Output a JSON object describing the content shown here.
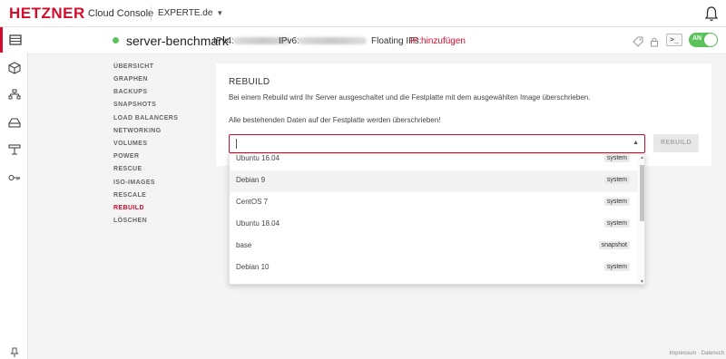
{
  "brand": {
    "logo": "HETZNER",
    "app_title": "Cloud Console"
  },
  "project": {
    "name": "EXPERTE.de"
  },
  "server": {
    "name": "server-benchmark",
    "status": "running",
    "ipv4_label": "IPv4:",
    "ipv6_label": "IPv6:",
    "floating_label": "Floating IPs:",
    "floating_link": "IP hinzufügen",
    "console_glyph": ">_",
    "power_toggle": "AN"
  },
  "subnav": {
    "items": [
      "ÜBERSICHT",
      "GRAPHEN",
      "BACKUPS",
      "SNAPSHOTS",
      "LOAD BALANCERS",
      "NETWORKING",
      "VOLUMES",
      "POWER",
      "RESCUE",
      "ISO-IMAGES",
      "RESCALE",
      "REBUILD",
      "LÖSCHEN"
    ],
    "active": "REBUILD"
  },
  "rebuild": {
    "title": "REBUILD",
    "text1": "Bei einem Rebuild wird Ihr Server ausgeschaltet und die Festplatte mit dem ausgewählten Image überschrieben.",
    "text2": "Alle bestehenden Daten auf der Festplatte werden überschrieben!",
    "select_value": "",
    "button_label": "REBUILD"
  },
  "dropdown": {
    "options": [
      {
        "name": "Ubuntu 16.04",
        "type": "system"
      },
      {
        "name": "Debian 9",
        "type": "system"
      },
      {
        "name": "CentOS 7",
        "type": "system"
      },
      {
        "name": "Ubuntu 18.04",
        "type": "system"
      },
      {
        "name": "base",
        "type": "snapshot"
      },
      {
        "name": "Debian 10",
        "type": "system"
      }
    ],
    "highlighted": "Debian 9"
  },
  "footer": {
    "links": "Impressum · Datensch"
  },
  "colors": {
    "brand_red": "#d50c2d",
    "status_green": "#5cc35c"
  },
  "icons": [
    "bell-icon",
    "servers-icon",
    "volumes-icon",
    "networks-icon",
    "load-balancers-icon",
    "floating-ips-icon",
    "access-key-icon",
    "pin-icon",
    "tag-icon",
    "lock-icon",
    "console-icon"
  ]
}
